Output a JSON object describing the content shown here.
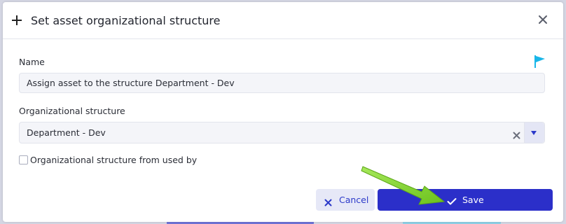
{
  "dialog": {
    "title": "Set asset organizational structure",
    "close_icon": "close-icon",
    "add_icon": "plus-icon"
  },
  "form": {
    "name_label": "Name",
    "name_value": "Assign asset to the structure Department - Dev",
    "flag_icon": "flag-icon",
    "structure_label": "Organizational structure",
    "structure_value": "Department - Dev",
    "used_by_checkbox_label": "Organizational structure from used by",
    "used_by_checked": false
  },
  "actions": {
    "cancel_label": "Cancel",
    "save_label": "Save"
  },
  "colors": {
    "primary": "#2b2fc9",
    "flag": "#19b6e8",
    "annotation_arrow": "#7ed321"
  }
}
